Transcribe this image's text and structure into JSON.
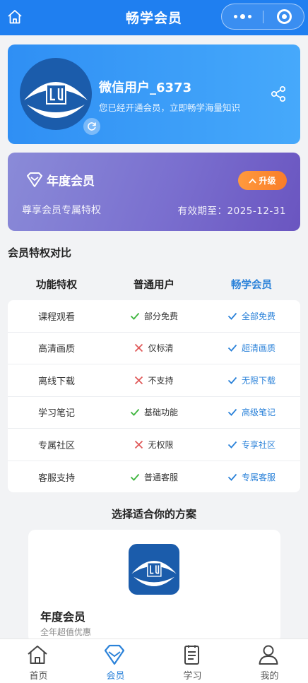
{
  "topbar": {
    "title": "畅学会员"
  },
  "profile": {
    "username": "微信用户_6373",
    "subtitle": "您已经开通会员，立即畅学海量知识"
  },
  "membership": {
    "title": "年度会员",
    "upgrade_label": "升级",
    "description": "尊享会员专属特权",
    "expiry": "有效期至：2025-12-31"
  },
  "comparison": {
    "section_title": "会员特权对比",
    "headers": [
      "功能特权",
      "普通用户",
      "畅学会员"
    ],
    "rows": [
      {
        "feature": "课程观看",
        "normal": "部分免费",
        "normal_icon": "check-icon",
        "vip": "全部免费"
      },
      {
        "feature": "高清画质",
        "normal": "仅标清",
        "normal_icon": "cross-icon",
        "vip": "超清画质"
      },
      {
        "feature": "离线下载",
        "normal": "不支持",
        "normal_icon": "cross-icon",
        "vip": "无限下载"
      },
      {
        "feature": "学习笔记",
        "normal": "基础功能",
        "normal_icon": "check-icon",
        "vip": "高级笔记"
      },
      {
        "feature": "专属社区",
        "normal": "无权限",
        "normal_icon": "cross-icon",
        "vip": "专享社区"
      },
      {
        "feature": "客服支持",
        "normal": "普通客服",
        "normal_icon": "check-icon",
        "vip": "专属客服"
      }
    ]
  },
  "plans": {
    "section_title": "选择适合你的方案",
    "items": [
      {
        "name": "年度会员",
        "subtitle": "全年超值优惠"
      }
    ]
  },
  "tabbar": {
    "items": [
      {
        "label": "首页",
        "icon": "home-icon",
        "active": false
      },
      {
        "label": "会员",
        "icon": "diamond-icon",
        "active": true
      },
      {
        "label": "学习",
        "icon": "document-icon",
        "active": false
      },
      {
        "label": "我的",
        "icon": "user-icon",
        "active": false
      }
    ]
  },
  "colors": {
    "primary": "#1f7ff0",
    "member_card": "#7a6fcf",
    "upgrade": "#f98a2f",
    "check_green": "#3eb53e",
    "cross_red": "#e05a5a",
    "vip_blue": "#2b82d9"
  }
}
